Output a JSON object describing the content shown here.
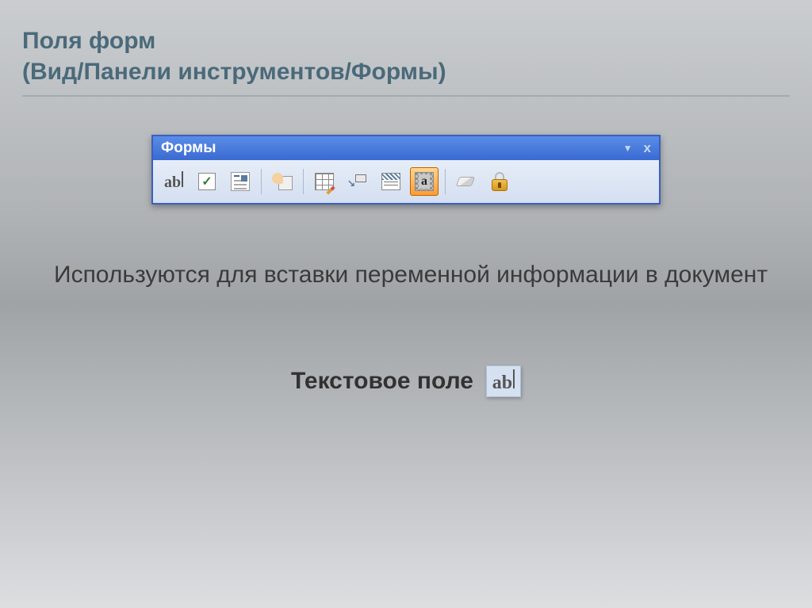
{
  "header": {
    "title_line1": "Поля форм",
    "title_line2": "(Вид/Панели инструментов/Формы)"
  },
  "toolbar": {
    "title": "Формы",
    "buttons": [
      {
        "name": "text-field",
        "label": "ab|"
      },
      {
        "name": "checkbox",
        "label": "✓"
      },
      {
        "name": "dropdown",
        "label": ""
      },
      {
        "name": "properties",
        "label": ""
      },
      {
        "name": "draw-table",
        "label": ""
      },
      {
        "name": "insert-frame",
        "label": ""
      },
      {
        "name": "shading",
        "label": ""
      },
      {
        "name": "reset-fields",
        "label": "a"
      },
      {
        "name": "clear-form",
        "label": ""
      },
      {
        "name": "protect-form",
        "label": ""
      }
    ]
  },
  "description": "Используются для вставки переменной информации в документ",
  "caption": {
    "label": "Текстовое поле"
  }
}
